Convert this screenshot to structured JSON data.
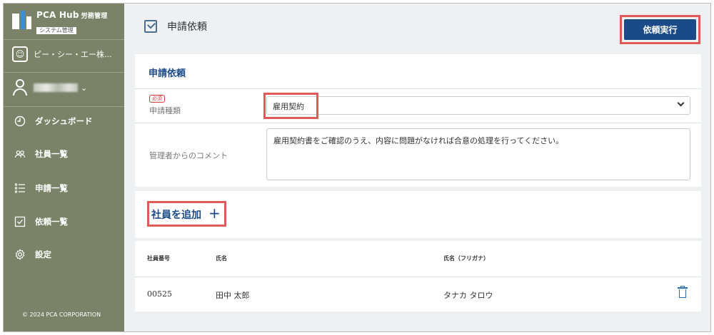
{
  "sidebar": {
    "logo_title": "PCA Hub",
    "logo_subtitle": "労務管理",
    "logo_badge": "システム管理",
    "company_name": "ピー・シー・エー株...",
    "user_chevron": "⌄",
    "nav": [
      {
        "label": "ダッシュボード",
        "icon": "clock-icon"
      },
      {
        "label": "社員一覧",
        "icon": "people-icon"
      },
      {
        "label": "申請一覧",
        "icon": "list-icon"
      },
      {
        "label": "依頼一覧",
        "icon": "checkbox-icon"
      },
      {
        "label": "設定",
        "icon": "gear-icon"
      }
    ],
    "copyright": "© 2024 PCA CORPORATION"
  },
  "header": {
    "title": "申請依頼",
    "execute_label": "依頼実行"
  },
  "request_section": {
    "title": "申請依頼",
    "required_badge": "必須",
    "type_label": "申請種類",
    "type_value": "雇用契約",
    "comment_label": "管理者からのコメント",
    "comment_value": "雇用契約書をご確認のうえ、内容に問題がなければ合意の処理を行ってください。"
  },
  "add_section": {
    "title": "社員を追加",
    "plus": "+"
  },
  "employee_table": {
    "headers": [
      "社員番号",
      "氏名",
      "氏名（フリガナ）"
    ],
    "rows": [
      {
        "id": "00525",
        "name": "田中 太郎",
        "kana": "タナカ タロウ"
      }
    ]
  },
  "colors": {
    "sidebar_bg": "#7c8268",
    "primary": "#1a4a88",
    "highlight": "#e05a5a"
  }
}
